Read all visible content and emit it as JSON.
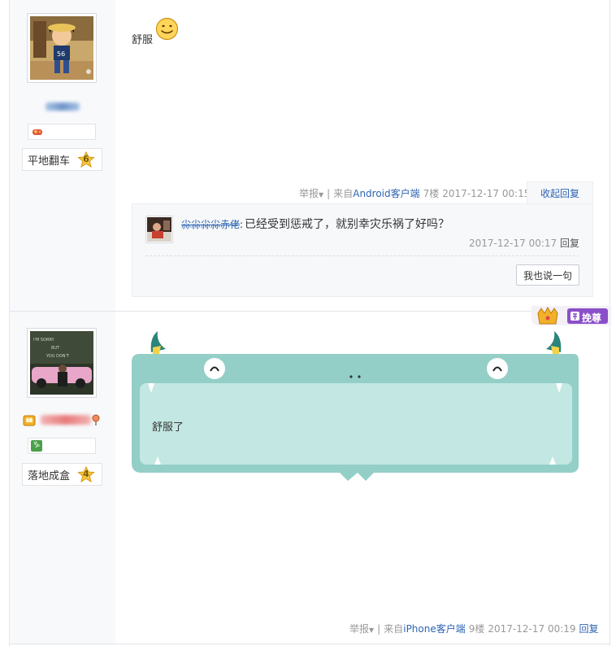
{
  "post1": {
    "content": "舒服",
    "emoji_icon": "smiley-face-icon",
    "user": {
      "level_name": "平地翻车",
      "level_number": "6"
    },
    "tail": {
      "report": "举报",
      "from_prefix": "来自",
      "client": "Android客户端",
      "floor": "7楼",
      "time": "2017-12-17 00:15",
      "collapse_reply": "收起回复"
    },
    "comments": [
      {
        "author": "尛尛尛尛赤佬",
        "separator": ":",
        "text": "已经受到惩戒了，就别幸灾乐祸了好吗？",
        "time": "2017-12-17 00:17",
        "reply": "回复"
      }
    ],
    "say_button": "我也说一句"
  },
  "post2": {
    "content": "舒服了",
    "user": {
      "level_name": "落地成盒",
      "level_number": "4"
    },
    "vip_label": "挽尊",
    "tail": {
      "report": "举报",
      "from_prefix": "来自",
      "client": "iPhone客户端",
      "floor": "9楼",
      "time": "2017-12-17 00:19",
      "reply": "回复"
    }
  },
  "colors": {
    "link": "#2d64b3",
    "meta": "#999999",
    "monster_body": "#93cfc7",
    "monster_inner": "#c3e7e2",
    "monster_horn": "#2a8479",
    "vip_purple": "#8b4fc9"
  }
}
